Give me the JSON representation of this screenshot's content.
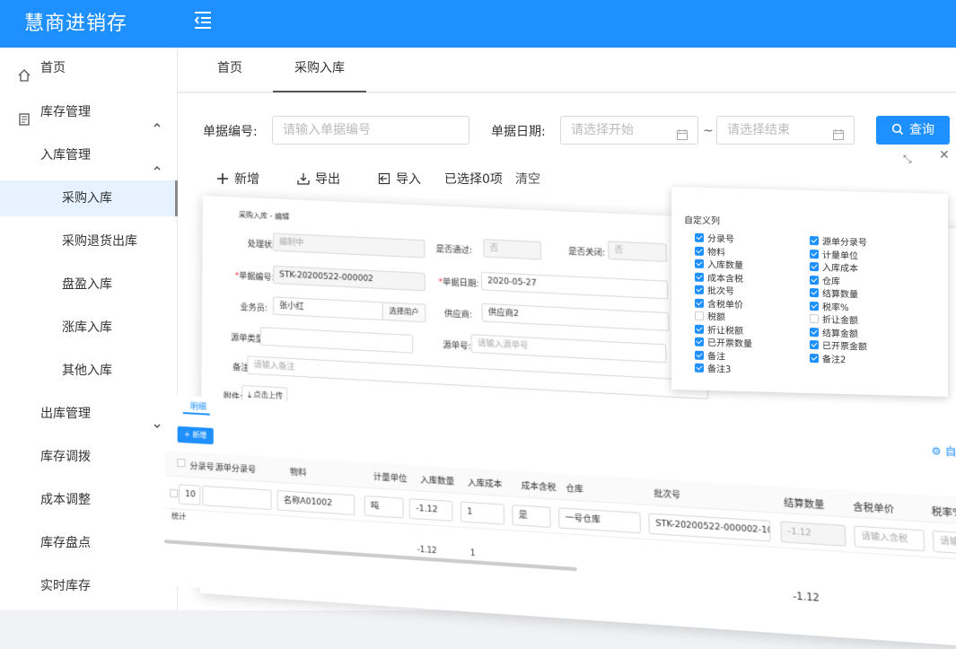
{
  "app": {
    "title": "慧商进销存"
  },
  "sidebar": {
    "items": [
      {
        "label": "首页",
        "icon": "home-icon"
      },
      {
        "label": "库存管理",
        "icon": "inventory-icon"
      },
      {
        "label": "入库管理"
      },
      {
        "label": "采购入库"
      },
      {
        "label": "采购退货出库"
      },
      {
        "label": "盘盈入库"
      },
      {
        "label": "涨库入库"
      },
      {
        "label": "其他入库"
      },
      {
        "label": "出库管理"
      },
      {
        "label": "库存调拨"
      },
      {
        "label": "成本调整"
      },
      {
        "label": "库存盘点"
      },
      {
        "label": "实时库存"
      }
    ]
  },
  "tabs": [
    {
      "label": "首页"
    },
    {
      "label": "采购入库"
    }
  ],
  "search": {
    "no_label": "单据编号:",
    "no_placeholder": "请输入单据编号",
    "date_label": "单据日期:",
    "start_placeholder": "请选择开始",
    "sep": "~",
    "end_placeholder": "请选择结束",
    "query_label": "查询"
  },
  "toolbar": {
    "add": "新增",
    "export": "导出",
    "import": "导入",
    "selected": "已选择0项",
    "clear": "清空"
  },
  "form": {
    "title": "采购入库 - 编辑",
    "status_label": "处理状态:",
    "status_value": "编制中",
    "approved_label": "是否通过:",
    "approved_value": "否",
    "closed_label": "是否关闭:",
    "closed_value": "否",
    "no_label": "单据编号:",
    "no_value": "STK-20200522-000002",
    "date_label": "单据日期:",
    "date_value": "2020-05-27",
    "clerk_label": "业务员:",
    "clerk_value": "张小红",
    "select_user": "选择用户",
    "supplier_label": "供应商:",
    "supplier_value": "供应商2",
    "src_type_label": "源单类型:",
    "src_no_label": "源单号:",
    "src_no_placeholder": "请输入源单号",
    "remark_label": "备注:",
    "remark_placeholder": "请输入备注",
    "attach_label": "附件:",
    "upload": "点击上传"
  },
  "columns_panel": {
    "title": "自定义列",
    "items": [
      {
        "label": "分录号",
        "checked": true
      },
      {
        "label": "源单分录号",
        "checked": true
      },
      {
        "label": "物料",
        "checked": true
      },
      {
        "label": "计量单位",
        "checked": true
      },
      {
        "label": "入库数量",
        "checked": true
      },
      {
        "label": "入库成本",
        "checked": true
      },
      {
        "label": "成本含税",
        "checked": true
      },
      {
        "label": "仓库",
        "checked": true
      },
      {
        "label": "批次号",
        "checked": true
      },
      {
        "label": "结算数量",
        "checked": true
      },
      {
        "label": "含税单价",
        "checked": true
      },
      {
        "label": "税率%",
        "checked": true
      },
      {
        "label": "税额",
        "checked": false
      },
      {
        "label": "折让金额",
        "checked": false
      },
      {
        "label": "折让税额",
        "checked": true
      },
      {
        "label": "结算金额",
        "checked": true
      },
      {
        "label": "已开票数量",
        "checked": true
      },
      {
        "label": "已开票金额",
        "checked": true
      },
      {
        "label": "备注",
        "checked": true
      },
      {
        "label": "备注2",
        "checked": true
      },
      {
        "label": "备注3",
        "checked": true
      }
    ]
  },
  "detail": {
    "tab": "明细",
    "add": "新增",
    "custom_cols": "自定义列",
    "headers": [
      "分录号",
      "源单分录号",
      "物料",
      "计量单位",
      "入库数量",
      "入库成本",
      "成本含税",
      "仓库",
      "批次号",
      "结算数量",
      "含税单价",
      "税率%"
    ],
    "row": {
      "entry_no": "10",
      "material": "名称A01002",
      "unit": "吨",
      "qty": "-1.12",
      "cost": "1",
      "tax_incl": "是",
      "warehouse": "一号仓库",
      "batch": "STK-20200522-000002-10",
      "settle_qty": "-1.12",
      "price_ph": "请输入含税",
      "rate_ph": "请输入税率"
    },
    "total_label": "统计",
    "total_qty": "-1.12",
    "total_cost": "1",
    "total_settle": "-1.12"
  },
  "colors": {
    "primary": "#1e90ff",
    "active_bg": "#e6f2ff"
  }
}
